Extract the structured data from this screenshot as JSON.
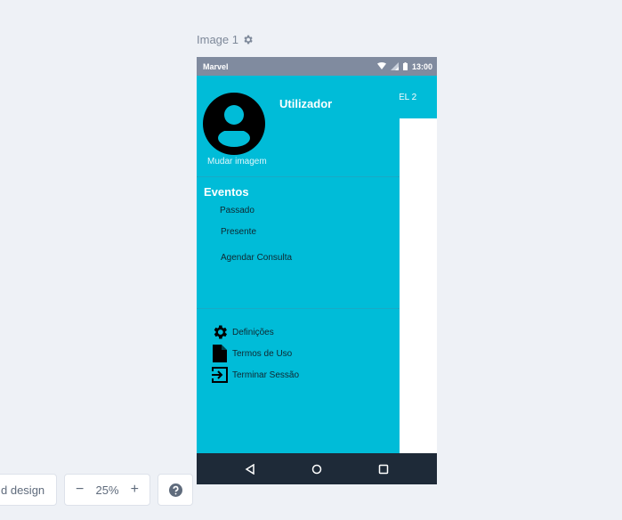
{
  "canvas": {
    "image_label": "Image 1",
    "gear_icon": "gear-icon"
  },
  "phone": {
    "status_bar": {
      "carrier": "Marvel",
      "time": "13:00",
      "icons": [
        "wifi-icon",
        "signal-icon",
        "battery-icon"
      ]
    },
    "app_bar": {
      "tab_label_partial": "EL 2",
      "color": "#00bcd8"
    },
    "drawer": {
      "color": "#00bcd8",
      "user_name": "Utilizador",
      "change_image": "Mudar imagem",
      "section_title": "Eventos",
      "menu_items": [
        "Passado",
        "Presente",
        "Agendar Consulta"
      ],
      "bottom_items": [
        {
          "label": "Definições",
          "icon": "gear-icon"
        },
        {
          "label": "Termos de Uso",
          "icon": "document-icon"
        },
        {
          "label": "Terminar Sessão",
          "icon": "logout-icon"
        }
      ]
    },
    "nav_bar": {
      "buttons": [
        "back-icon",
        "home-icon",
        "recents-icon"
      ],
      "color": "#1e2a38"
    }
  },
  "toolbar": {
    "design_label": "d design",
    "zoom_value": "25%",
    "zoom_out": "−",
    "zoom_in": "+",
    "help_icon": "help-icon"
  }
}
